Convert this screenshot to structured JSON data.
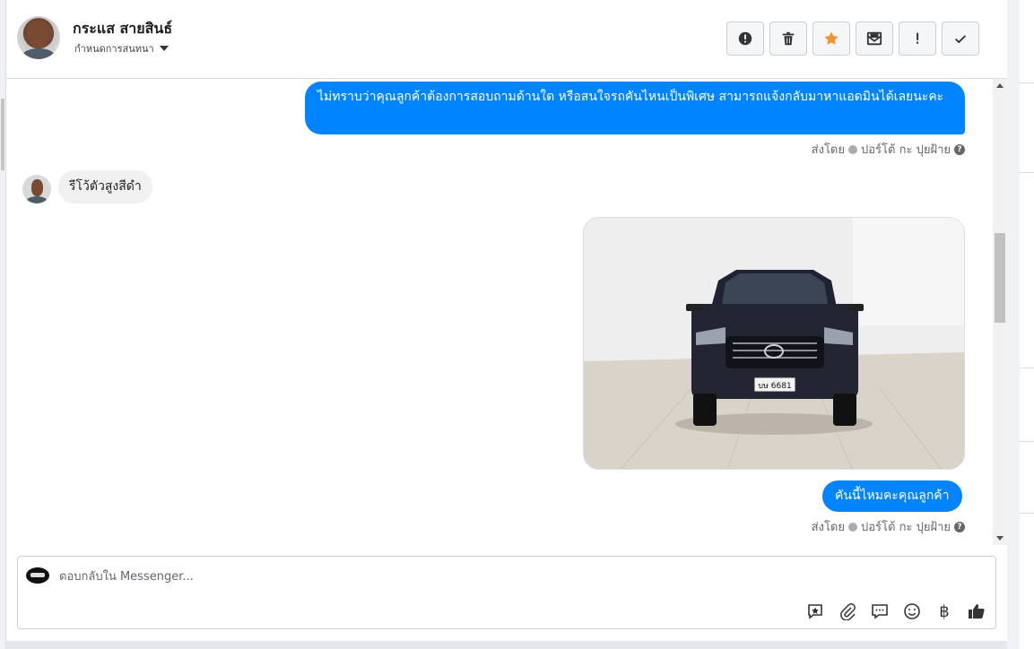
{
  "header": {
    "contact_name": "กระแส สายสินธ์",
    "conversation_label": "กำหนดการสนทนา",
    "actions": [
      {
        "name": "report-button",
        "icon": "alert-circle-icon"
      },
      {
        "name": "delete-button",
        "icon": "trash-icon"
      },
      {
        "name": "star-button",
        "icon": "star-icon"
      },
      {
        "name": "mark-unread-button",
        "icon": "envelope-icon"
      },
      {
        "name": "important-button",
        "icon": "exclamation-icon"
      },
      {
        "name": "done-button",
        "icon": "check-icon"
      }
    ],
    "star_color": "#f5922f"
  },
  "messages": {
    "outgoing_1": "ไม่ทราบว่าคุณลูกค้าต้องการสอบถามด้านใด หรือสนใจรถคันไหนเป็นพิเศษ สามารถแจ้งกลับมาหาแอดมินได้เลยนะคะ",
    "sent_by_1_prefix": "ส่งโดย",
    "sent_by_1_name": "ปอร์โต้ กะ ปุยฝ้าย",
    "incoming_1": "รีโว้ตัวสูงสีดำ",
    "photo_plate": "บษ 6681",
    "outgoing_2": "คันนี้ไหมคะคุณลูกค้า",
    "sent_by_2_prefix": "ส่งโดย",
    "sent_by_2_name": "ปอร์โต้ กะ ปุยฝ้าย"
  },
  "composer": {
    "placeholder": "ตอบกลับใน Messenger...",
    "tools": [
      "saved-reply-icon",
      "attachment-icon",
      "chat-bubble-icon",
      "emoji-icon",
      "baht-icon",
      "thumbs-up-icon"
    ],
    "baht_symbol": "฿"
  },
  "colors": {
    "accent": "#0084ff",
    "incoming_bubble": "#f0f0f0"
  }
}
